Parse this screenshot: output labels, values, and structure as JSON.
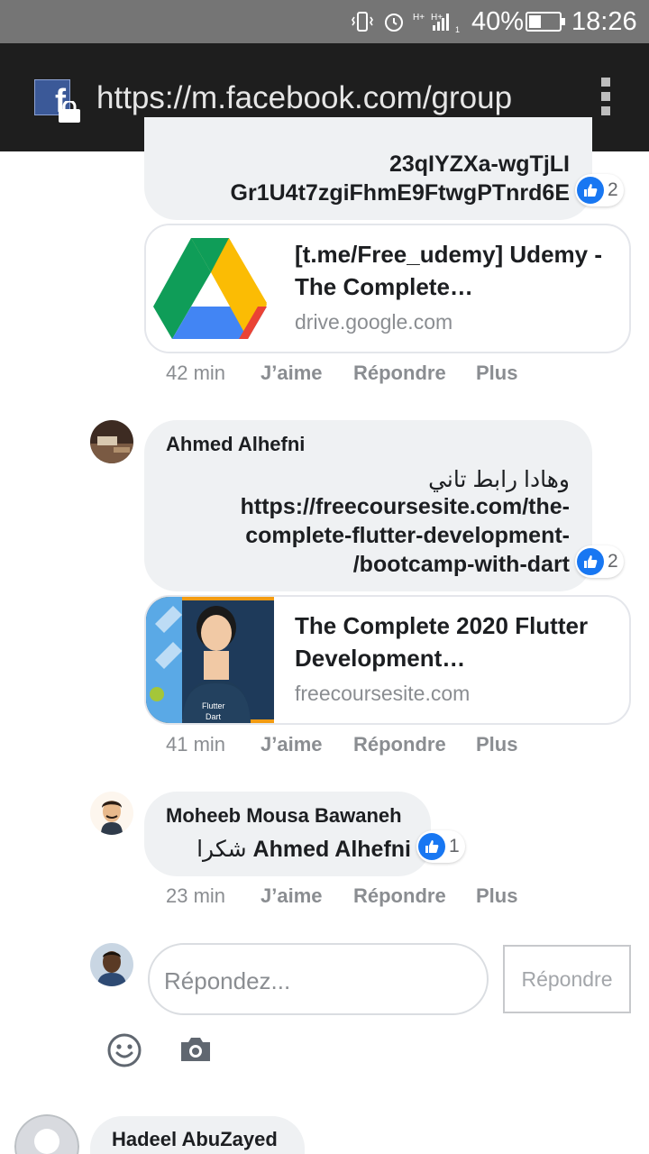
{
  "status_bar": {
    "battery_percent": "40%",
    "battery_level": 0.4,
    "time": "18:26"
  },
  "browser": {
    "url": "https://m.facebook.com/group"
  },
  "comments": [
    {
      "body_lines": [
        "23qIYZXa-wgTjLI",
        "Gr1U4t7zgiFhmE9FtwgPTnrd6E"
      ],
      "reaction_count": "2",
      "link_card": {
        "title": "[t.me/Free_udemy] Udemy - The Complete…",
        "domain": "drive.google.com"
      },
      "time": "42 min",
      "like_label": "J’aime",
      "reply_label": "Répondre",
      "more_label": "Plus"
    },
    {
      "author": "Ahmed Alhefni",
      "body_lines": [
        "وهادا رابط تاني",
        "https://freecoursesite.com/the-",
        "complete-flutter-development-",
        "/bootcamp-with-dart"
      ],
      "reaction_count": "2",
      "link_card": {
        "title": "The Complete 2020 Flutter Development…",
        "domain": "freecoursesite.com",
        "thumb_badge": "Flutter",
        "thumb_badge2": "Dart"
      },
      "time": "41 min",
      "like_label": "J’aime",
      "reply_label": "Répondre",
      "more_label": "Plus"
    },
    {
      "author": "Moheeb Mousa Bawaneh",
      "body_mention": "Ahmed Alhefni",
      "body_text": "شكرا",
      "reaction_count": "1",
      "time": "23 min",
      "like_label": "J’aime",
      "reply_label": "Répondre",
      "more_label": "Plus"
    }
  ],
  "reply_box": {
    "placeholder": "Répondez...",
    "button_label": "Répondre"
  },
  "next_comment": {
    "author": "Hadeel AbuZayed"
  },
  "colors": {
    "like_blue": "#1877f2",
    "bubble_bg": "#eff1f3",
    "muted_text": "#8a8d91",
    "status_bar": "#757575",
    "url_bar": "#1e1e1e"
  }
}
